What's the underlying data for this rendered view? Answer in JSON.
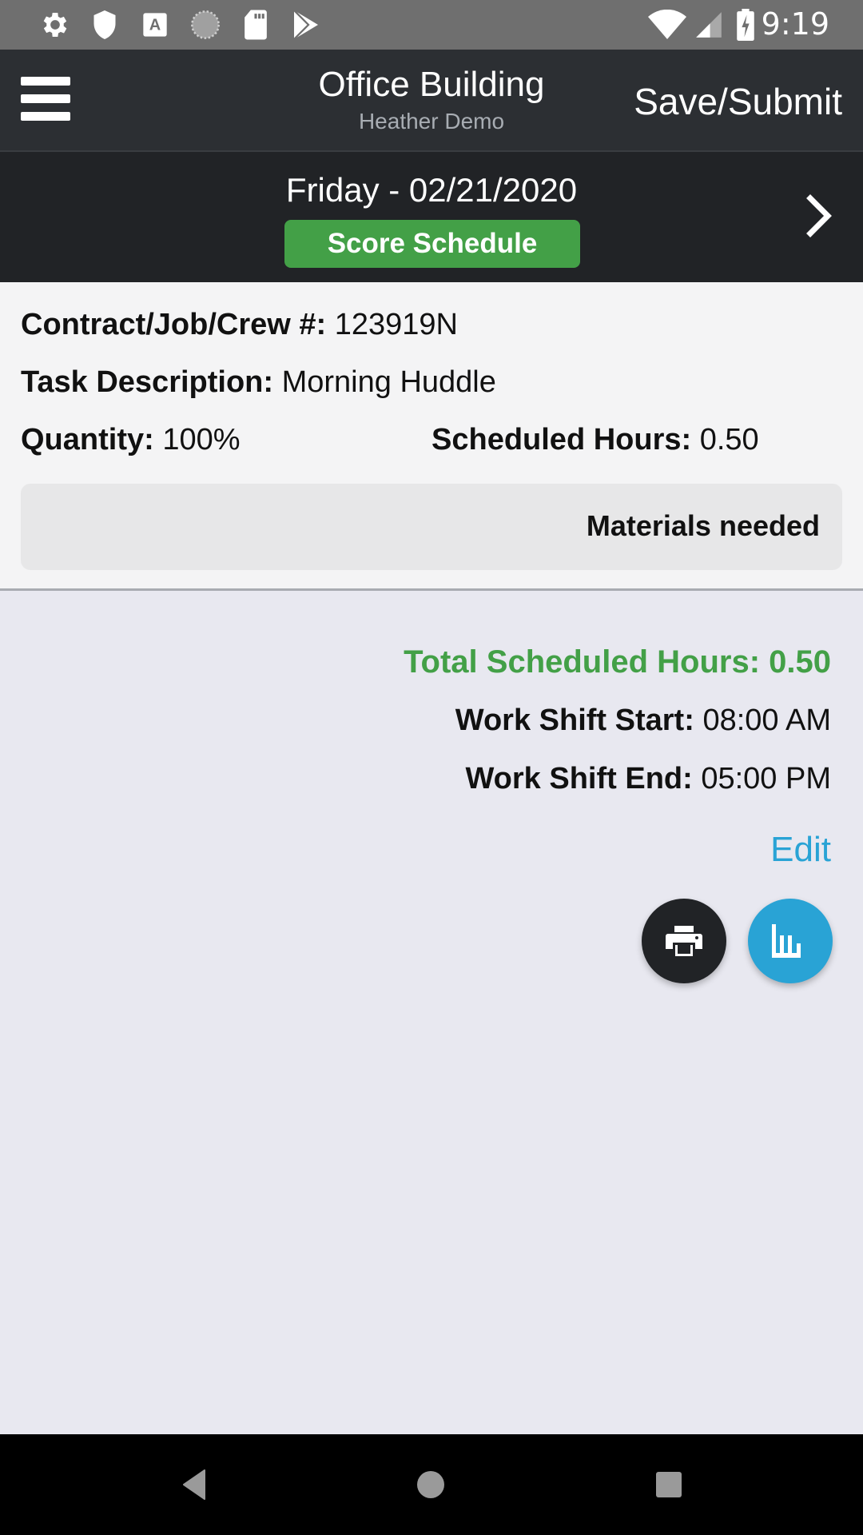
{
  "status_bar": {
    "left_icons": [
      "settings-icon",
      "shield-icon",
      "accessibility-a-icon",
      "sync-circle-icon",
      "sd-card-icon",
      "play-store-icon"
    ],
    "right_icons": [
      "wifi-icon",
      "cell-signal-icon",
      "battery-charging-icon"
    ],
    "time": "9:19"
  },
  "header": {
    "title": "Office Building",
    "subtitle": "Heather Demo",
    "save_label": "Save/Submit"
  },
  "date_bar": {
    "date": "Friday - 02/21/2020",
    "score_button_label": "Score Schedule"
  },
  "details": {
    "contract_label": "Contract/Job/Crew #:",
    "contract_value": "123919N",
    "task_label": "Task Description:",
    "task_value": "Morning Huddle",
    "quantity_label": "Quantity:",
    "quantity_value": "100%",
    "scheduled_hours_label": "Scheduled Hours:",
    "scheduled_hours_value": "0.50",
    "materials_label": "Materials needed"
  },
  "summary": {
    "total_label": "Total Scheduled Hours: 0.50",
    "shift_start_label": "Work Shift Start:",
    "shift_start_value": "08:00 AM",
    "shift_end_label": "Work Shift End:",
    "shift_end_value": "05:00 PM",
    "edit_label": "Edit"
  },
  "colors": {
    "accent_green": "#43a047",
    "accent_blue": "#29a3d5",
    "header_dark": "#2c2f33"
  }
}
